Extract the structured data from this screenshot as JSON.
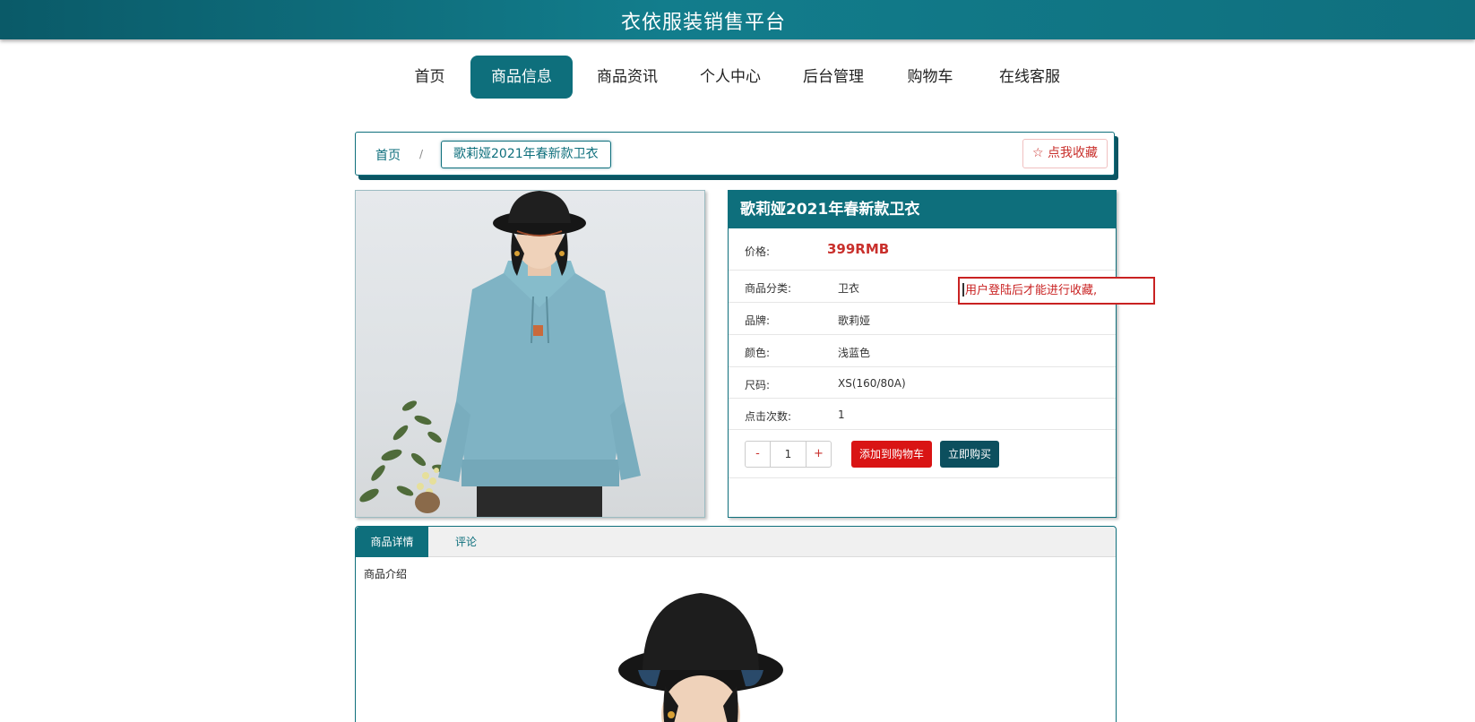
{
  "site": {
    "title": "衣依服装销售平台"
  },
  "nav": {
    "items": [
      {
        "label": "首页"
      },
      {
        "label": "商品信息"
      },
      {
        "label": "商品资讯"
      },
      {
        "label": "个人中心"
      },
      {
        "label": "后台管理"
      },
      {
        "label": "购物车"
      },
      {
        "label": "在线客服"
      }
    ],
    "active_index": 1
  },
  "breadcrumb": {
    "home": "首页",
    "separator": "/",
    "current": "歌莉娅2021年春新款卫衣",
    "favorite_label": "点我收藏",
    "favorite_icon": "star-outline-icon"
  },
  "product": {
    "title": "歌莉娅2021年春新款卫衣",
    "price_label": "价格:",
    "price_value": "399RMB",
    "fields": [
      {
        "label": "商品分类:",
        "value": "卫衣"
      },
      {
        "label": "品牌:",
        "value": "歌莉娅"
      },
      {
        "label": "颜色:",
        "value": "浅蓝色"
      },
      {
        "label": "尺码:",
        "value": "XS(160/80A)"
      },
      {
        "label": "点击次数:",
        "value": "1"
      }
    ],
    "quantity": "1",
    "minus_label": "-",
    "plus_label": "+",
    "add_cart_label": "添加到购物车",
    "buy_now_label": "立即购买"
  },
  "tooltip": {
    "text": "用户登陆后才能进行收藏,"
  },
  "detail": {
    "tabs": [
      {
        "label": "商品详情"
      },
      {
        "label": "评论"
      }
    ],
    "intro_label": "商品介绍"
  },
  "colors": {
    "primary": "#0e6f7c",
    "danger": "#d91414",
    "dark_teal": "#0c4f5e",
    "price": "#c9302c"
  }
}
